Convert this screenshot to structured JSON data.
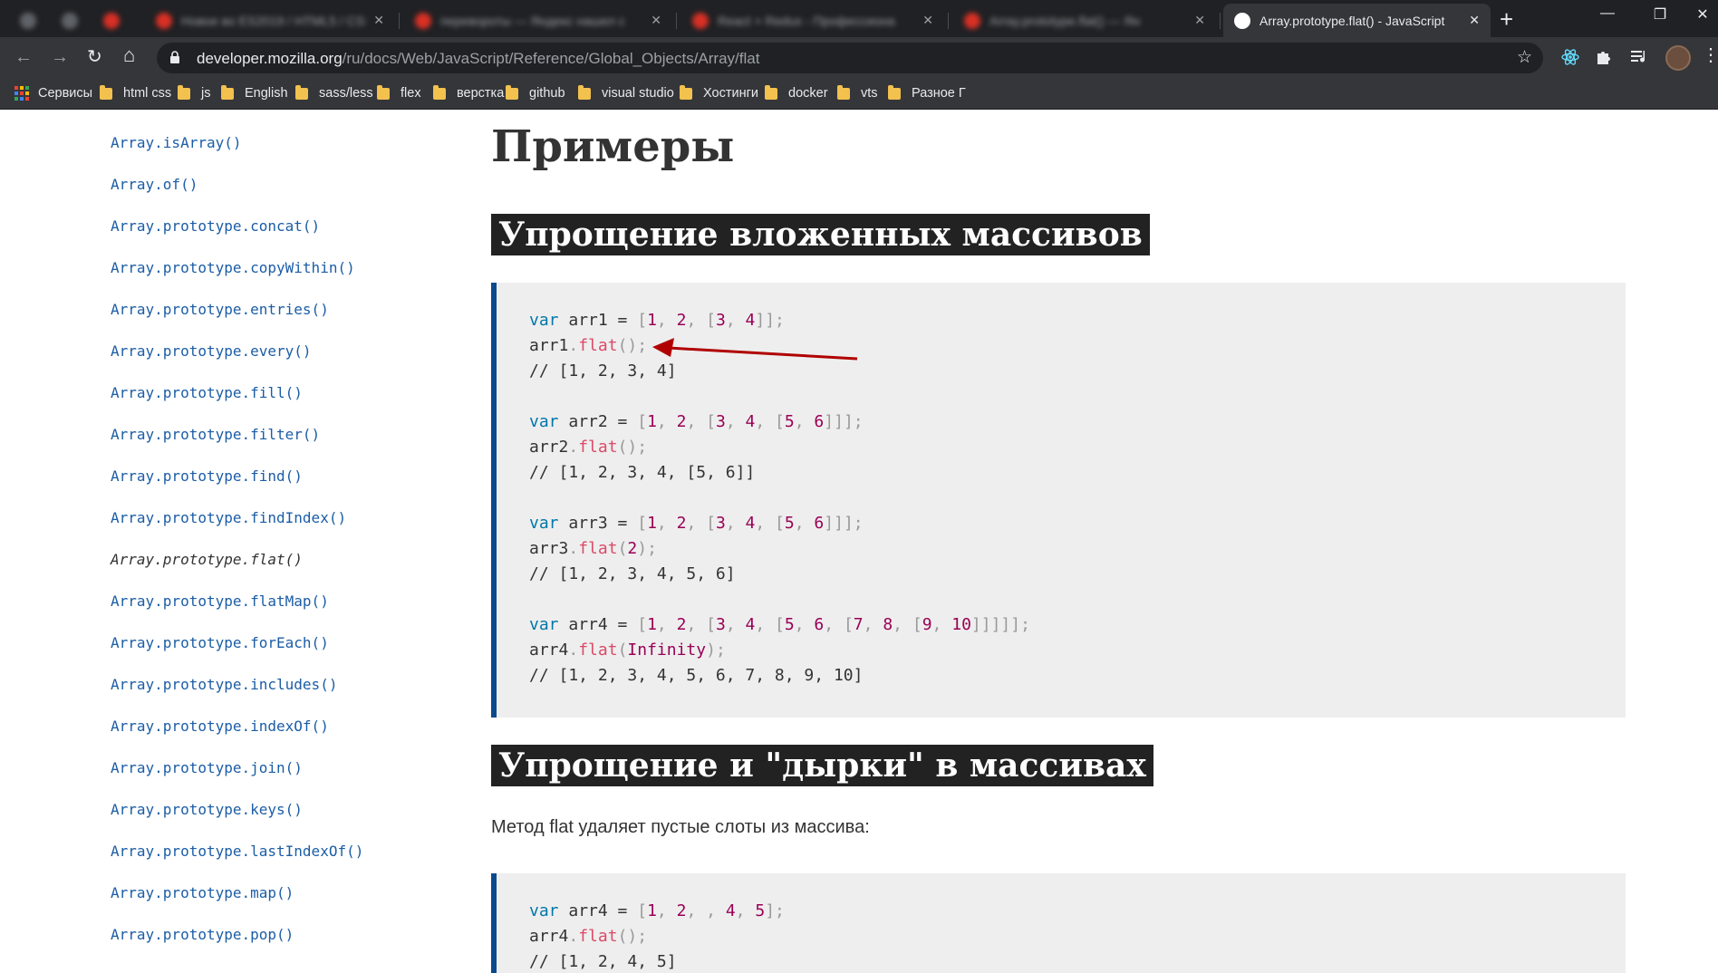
{
  "browser": {
    "tabs": [
      {
        "title": "Blurred tab",
        "color": "#5f6368"
      },
      {
        "title": "Blurred tab",
        "color": "#5f6368"
      },
      {
        "title": "Blurred tab",
        "color": "#d93025"
      },
      {
        "title": "Новое во ES2019 / HTML5 / CSS",
        "color": "#d93025"
      },
      {
        "title": "перевороты — Яндекс нашел с",
        "color": "#d93025"
      },
      {
        "title": "React + Redux - Профессиона",
        "color": "#d93025"
      },
      {
        "title": "Array.prototype.flat() — Ян",
        "color": "#d93025"
      },
      {
        "title": "Array.prototype.flat() - JavaScript",
        "color": "#ffffff"
      }
    ],
    "new_tab": "+",
    "window": {
      "minimize": "—",
      "restore": "❐",
      "close": "✕"
    },
    "nav": {
      "back": "←",
      "forward": "→",
      "reload": "↻",
      "home": "⌂"
    },
    "url": {
      "host": "developer.mozilla.org",
      "path": "/ru/docs/Web/JavaScript/Reference/Global_Objects/Array/flat"
    },
    "bookmarks": [
      "Сервисы",
      "html css",
      "js",
      "English",
      "sass/less",
      "flex",
      "верстка",
      "github",
      "visual studio",
      "Хостинги",
      "docker",
      "vts",
      "Разное Г"
    ]
  },
  "sidebar": {
    "items": [
      "Array.isArray()",
      "Array.of()",
      "Array.prototype.concat()",
      "Array.prototype.copyWithin()",
      "Array.prototype.entries()",
      "Array.prototype.every()",
      "Array.prototype.fill()",
      "Array.prototype.filter()",
      "Array.prototype.find()",
      "Array.prototype.findIndex()",
      "Array.prototype.flat()",
      "Array.prototype.flatMap()",
      "Array.prototype.forEach()",
      "Array.prototype.includes()",
      "Array.prototype.indexOf()",
      "Array.prototype.join()",
      "Array.prototype.keys()",
      "Array.prototype.lastIndexOf()",
      "Array.prototype.map()",
      "Array.prototype.pop()"
    ],
    "current": "Array.prototype.flat()"
  },
  "content": {
    "heading": "Примеры",
    "section1": {
      "title": "Упрощение вложенных массивов",
      "code": [
        [
          [
            "kw",
            "var"
          ],
          [
            "t",
            " arr1 "
          ],
          [
            "t",
            "="
          ],
          [
            "t",
            " "
          ],
          [
            "pun",
            "["
          ],
          [
            "num",
            "1"
          ],
          [
            "pun",
            ", "
          ],
          [
            "num",
            "2"
          ],
          [
            "pun",
            ", "
          ],
          [
            "pun",
            "["
          ],
          [
            "num",
            "3"
          ],
          [
            "pun",
            ", "
          ],
          [
            "num",
            "4"
          ],
          [
            "pun",
            "]];"
          ]
        ],
        [
          [
            "t",
            "arr1"
          ],
          [
            "pun",
            "."
          ],
          [
            "fn",
            "flat"
          ],
          [
            "pun",
            "();"
          ]
        ],
        [
          [
            "cm",
            "// [1, 2, 3, 4]"
          ]
        ],
        [],
        [
          [
            "kw",
            "var"
          ],
          [
            "t",
            " arr2 "
          ],
          [
            "t",
            "="
          ],
          [
            "t",
            " "
          ],
          [
            "pun",
            "["
          ],
          [
            "num",
            "1"
          ],
          [
            "pun",
            ", "
          ],
          [
            "num",
            "2"
          ],
          [
            "pun",
            ", "
          ],
          [
            "pun",
            "["
          ],
          [
            "num",
            "3"
          ],
          [
            "pun",
            ", "
          ],
          [
            "num",
            "4"
          ],
          [
            "pun",
            ", "
          ],
          [
            "pun",
            "["
          ],
          [
            "num",
            "5"
          ],
          [
            "pun",
            ", "
          ],
          [
            "num",
            "6"
          ],
          [
            "pun",
            "]]];"
          ]
        ],
        [
          [
            "t",
            "arr2"
          ],
          [
            "pun",
            "."
          ],
          [
            "fn",
            "flat"
          ],
          [
            "pun",
            "();"
          ]
        ],
        [
          [
            "cm",
            "// [1, 2, 3, 4, [5, 6]]"
          ]
        ],
        [],
        [
          [
            "kw",
            "var"
          ],
          [
            "t",
            " arr3 "
          ],
          [
            "t",
            "="
          ],
          [
            "t",
            " "
          ],
          [
            "pun",
            "["
          ],
          [
            "num",
            "1"
          ],
          [
            "pun",
            ", "
          ],
          [
            "num",
            "2"
          ],
          [
            "pun",
            ", "
          ],
          [
            "pun",
            "["
          ],
          [
            "num",
            "3"
          ],
          [
            "pun",
            ", "
          ],
          [
            "num",
            "4"
          ],
          [
            "pun",
            ", "
          ],
          [
            "pun",
            "["
          ],
          [
            "num",
            "5"
          ],
          [
            "pun",
            ", "
          ],
          [
            "num",
            "6"
          ],
          [
            "pun",
            "]]];"
          ]
        ],
        [
          [
            "t",
            "arr3"
          ],
          [
            "pun",
            "."
          ],
          [
            "fn",
            "flat"
          ],
          [
            "pun",
            "("
          ],
          [
            "num",
            "2"
          ],
          [
            "pun",
            ");"
          ]
        ],
        [
          [
            "cm",
            "// [1, 2, 3, 4, 5, 6]"
          ]
        ],
        [],
        [
          [
            "kw",
            "var"
          ],
          [
            "t",
            " arr4 "
          ],
          [
            "t",
            "="
          ],
          [
            "t",
            " "
          ],
          [
            "pun",
            "["
          ],
          [
            "num",
            "1"
          ],
          [
            "pun",
            ", "
          ],
          [
            "num",
            "2"
          ],
          [
            "pun",
            ", "
          ],
          [
            "pun",
            "["
          ],
          [
            "num",
            "3"
          ],
          [
            "pun",
            ", "
          ],
          [
            "num",
            "4"
          ],
          [
            "pun",
            ", "
          ],
          [
            "pun",
            "["
          ],
          [
            "num",
            "5"
          ],
          [
            "pun",
            ", "
          ],
          [
            "num",
            "6"
          ],
          [
            "pun",
            ", "
          ],
          [
            "pun",
            "["
          ],
          [
            "num",
            "7"
          ],
          [
            "pun",
            ", "
          ],
          [
            "num",
            "8"
          ],
          [
            "pun",
            ", "
          ],
          [
            "pun",
            "["
          ],
          [
            "num",
            "9"
          ],
          [
            "pun",
            ", "
          ],
          [
            "num",
            "10"
          ],
          [
            "pun",
            "]]]]];"
          ]
        ],
        [
          [
            "t",
            "arr4"
          ],
          [
            "pun",
            "."
          ],
          [
            "fn",
            "flat"
          ],
          [
            "pun",
            "("
          ],
          [
            "num",
            "Infinity"
          ],
          [
            "pun",
            ");"
          ]
        ],
        [
          [
            "cm",
            "// [1, 2, 3, 4, 5, 6, 7, 8, 9, 10]"
          ]
        ]
      ]
    },
    "section2": {
      "title": "Упрощение и \"дырки\" в массивах",
      "paragraph": "Метод flat удаляет пустые слоты из массива:",
      "code": [
        [
          [
            "kw",
            "var"
          ],
          [
            "t",
            " arr4 "
          ],
          [
            "t",
            "="
          ],
          [
            "t",
            " "
          ],
          [
            "pun",
            "["
          ],
          [
            "num",
            "1"
          ],
          [
            "pun",
            ", "
          ],
          [
            "num",
            "2"
          ],
          [
            "pun",
            ", , "
          ],
          [
            "num",
            "4"
          ],
          [
            "pun",
            ", "
          ],
          [
            "num",
            "5"
          ],
          [
            "pun",
            "];"
          ]
        ],
        [
          [
            "t",
            "arr4"
          ],
          [
            "pun",
            "."
          ],
          [
            "fn",
            "flat"
          ],
          [
            "pun",
            "();"
          ]
        ],
        [
          [
            "cm",
            "// [1, 2, 4, 5]"
          ]
        ]
      ]
    }
  },
  "colors": {
    "chrome_dark": "#202124",
    "chrome_toolbar": "#35363a",
    "link": "#1b5da6",
    "code_border": "#0a4a8c",
    "annotation_arrow": "#b00000"
  }
}
